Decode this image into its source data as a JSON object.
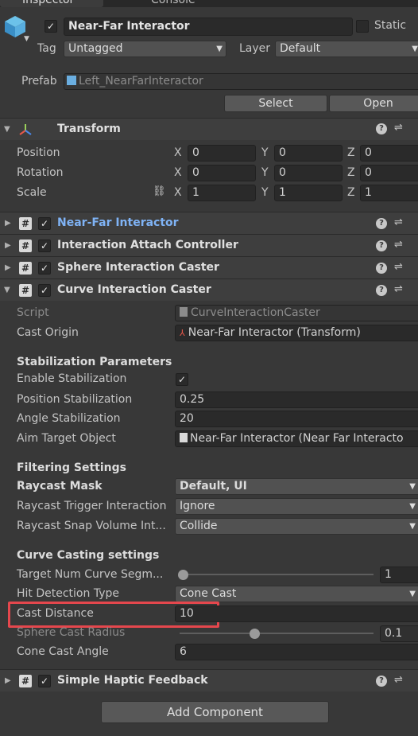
{
  "tabs": {
    "inspector": "Inspector",
    "console": "Console"
  },
  "object": {
    "name": "Near-Far Interactor",
    "static_label": "Static",
    "tag_label": "Tag",
    "tag_value": "Untagged",
    "layer_label": "Layer",
    "layer_value": "Default",
    "prefab_label": "Prefab",
    "prefab_value": "Left_NearFarInteractor",
    "select_label": "Select",
    "open_label": "Open"
  },
  "transform": {
    "title": "Transform",
    "rows": [
      {
        "label": "Position",
        "x": "0",
        "y": "0",
        "z": "0"
      },
      {
        "label": "Rotation",
        "x": "0",
        "y": "0",
        "z": "0"
      },
      {
        "label": "Scale",
        "x": "1",
        "y": "1",
        "z": "1"
      }
    ],
    "axis": {
      "x": "X",
      "y": "Y",
      "z": "Z"
    }
  },
  "components": {
    "near_far": "Near-Far Interactor",
    "attach": "Interaction Attach Controller",
    "sphere": "Sphere Interaction Caster",
    "curve": "Curve Interaction Caster",
    "haptic": "Simple Haptic Feedback"
  },
  "curve": {
    "script_label": "Script",
    "script_value": "CurveInteractionCaster",
    "cast_origin_label": "Cast Origin",
    "cast_origin_value": "Near-Far Interactor (Transform)",
    "stab_header": "Stabilization Parameters",
    "enable_stab_label": "Enable Stabilization",
    "pos_stab_label": "Position Stabilization",
    "pos_stab_value": "0.25",
    "angle_stab_label": "Angle Stabilization",
    "angle_stab_value": "20",
    "aim_label": "Aim Target Object",
    "aim_value": "Near-Far Interactor (Near Far Interacto",
    "filter_header": "Filtering Settings",
    "raycast_mask_label": "Raycast Mask",
    "raycast_mask_value": "Default, UI",
    "trigger_label": "Raycast Trigger Interaction",
    "trigger_value": "Ignore",
    "snap_label": "Raycast Snap Volume Int...",
    "snap_value": "Collide",
    "casting_header": "Curve Casting settings",
    "segments_label": "Target Num Curve Segm...",
    "segments_value": "1",
    "segments_fraction": 0,
    "hit_label": "Hit Detection Type",
    "hit_value": "Cone Cast",
    "distance_label": "Cast Distance",
    "distance_value": "10",
    "radius_label": "Sphere Cast Radius",
    "radius_value": "0.1",
    "radius_fraction": 0.39,
    "cone_label": "Cone Cast Angle",
    "cone_value": "6"
  },
  "add_component": "Add Component",
  "colors": {
    "highlight": "#e5474d",
    "link_blue": "#7fb3f5",
    "background": "#383838"
  }
}
